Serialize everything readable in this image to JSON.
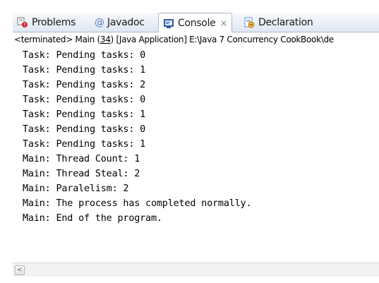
{
  "tabs": [
    {
      "label": "Problems",
      "icon": "problems-icon"
    },
    {
      "label": "Javadoc",
      "icon": "at-icon"
    },
    {
      "label": "Console",
      "icon": "console-icon",
      "active": true
    },
    {
      "label": "Declaration",
      "icon": "declaration-icon"
    }
  ],
  "close_glyph": "⨯",
  "status": {
    "prefix": "<terminated> Main (",
    "number": "34",
    "suffix": ") [Java Application] E:\\Java 7 Concurrency CookBook\\de"
  },
  "console_lines": [
    "Task: Pending tasks: 0",
    "Task: Pending tasks: 1",
    "Task: Pending tasks: 2",
    "Task: Pending tasks: 0",
    "Task: Pending tasks: 1",
    "Task: Pending tasks: 0",
    "Task: Pending tasks: 1",
    "Main: Thread Count: 1",
    "Main: Thread Steal: 2",
    "Main: Paralelism: 2",
    "Main: The process has completed normally.",
    "Main: End of the program."
  ],
  "scroll_left_glyph": "<",
  "colors": {
    "accent": "#2c5aa0",
    "tab_bar": "#dfe7f2"
  }
}
